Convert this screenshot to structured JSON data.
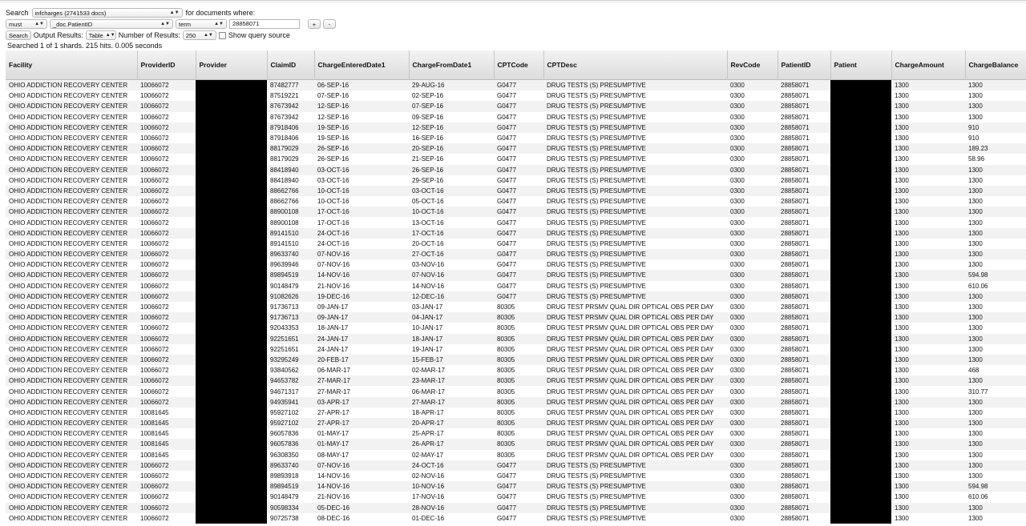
{
  "search_bar": {
    "search_label": "Search",
    "index_select": "infcharges (2741533 docs)",
    "for_documents_label": "for documents where:",
    "occur_select": "must",
    "field_select": "_doc.PatientID",
    "query_type_select": "term",
    "query_value": "28858071",
    "add_button": "+",
    "remove_button": "-",
    "search_button": "Search",
    "output_results_label": "Output Results:",
    "output_format_select": "Table",
    "number_of_results_label": "Number of Results:",
    "number_of_results_select": "250",
    "show_query_source_label": "Show query source"
  },
  "status_text": "Searched 1 of 1 shards. 215 hits. 0.005 seconds",
  "table": {
    "columns": [
      "Facility",
      "ProviderID",
      "Provider",
      "ClaimID",
      "ChargeEnteredDate1",
      "ChargeFromDate1",
      "CPTCode",
      "CPTDesc",
      "RevCode",
      "PatientID",
      "Patient",
      "ChargeAmount",
      "ChargeBalance"
    ],
    "rows": [
      [
        "OHIO ADDICTION RECOVERY CENTER",
        "10066072",
        "",
        "87482777",
        "06-SEP-16",
        "29-AUG-16",
        "G0477",
        "DRUG TESTS (S) PRESUMPTIVE",
        "0300",
        "28858071",
        "",
        "1300",
        "1300"
      ],
      [
        "OHIO ADDICTION RECOVERY CENTER",
        "10066072",
        "",
        "87519221",
        "07-SEP-16",
        "02-SEP-16",
        "G0477",
        "DRUG TESTS (S) PRESUMPTIVE",
        "0300",
        "28858071",
        "",
        "1300",
        "1300"
      ],
      [
        "OHIO ADDICTION RECOVERY CENTER",
        "10066072",
        "",
        "87673942",
        "12-SEP-16",
        "07-SEP-16",
        "G0477",
        "DRUG TESTS (S) PRESUMPTIVE",
        "0300",
        "28858071",
        "",
        "1300",
        "1300"
      ],
      [
        "OHIO ADDICTION RECOVERY CENTER",
        "10066072",
        "",
        "87673942",
        "12-SEP-16",
        "09-SEP-16",
        "G0477",
        "DRUG TESTS (S) PRESUMPTIVE",
        "0300",
        "28858071",
        "",
        "1300",
        "1300"
      ],
      [
        "OHIO ADDICTION RECOVERY CENTER",
        "10066072",
        "",
        "87918406",
        "19-SEP-16",
        "12-SEP-16",
        "G0477",
        "DRUG TESTS (S) PRESUMPTIVE",
        "0300",
        "28858071",
        "",
        "1300",
        "910"
      ],
      [
        "OHIO ADDICTION RECOVERY CENTER",
        "10066072",
        "",
        "87918406",
        "19-SEP-16",
        "16-SEP-16",
        "G0477",
        "DRUG TESTS (S) PRESUMPTIVE",
        "0300",
        "28858071",
        "",
        "1300",
        "910"
      ],
      [
        "OHIO ADDICTION RECOVERY CENTER",
        "10066072",
        "",
        "88179029",
        "26-SEP-16",
        "20-SEP-16",
        "G0477",
        "DRUG TESTS (S) PRESUMPTIVE",
        "0300",
        "28858071",
        "",
        "1300",
        "189.23"
      ],
      [
        "OHIO ADDICTION RECOVERY CENTER",
        "10066072",
        "",
        "88179029",
        "26-SEP-16",
        "21-SEP-16",
        "G0477",
        "DRUG TESTS (S) PRESUMPTIVE",
        "0300",
        "28858071",
        "",
        "1300",
        "58.96"
      ],
      [
        "OHIO ADDICTION RECOVERY CENTER",
        "10066072",
        "",
        "88418940",
        "03-OCT-16",
        "26-SEP-16",
        "G0477",
        "DRUG TESTS (S) PRESUMPTIVE",
        "0300",
        "28858071",
        "",
        "1300",
        "1300"
      ],
      [
        "OHIO ADDICTION RECOVERY CENTER",
        "10066072",
        "",
        "88418940",
        "03-OCT-16",
        "29-SEP-16",
        "G0477",
        "DRUG TESTS (S) PRESUMPTIVE",
        "0300",
        "28858071",
        "",
        "1300",
        "1300"
      ],
      [
        "OHIO ADDICTION RECOVERY CENTER",
        "10066072",
        "",
        "88662766",
        "10-OCT-16",
        "03-OCT-16",
        "G0477",
        "DRUG TESTS (S) PRESUMPTIVE",
        "0300",
        "28858071",
        "",
        "1300",
        "1300"
      ],
      [
        "OHIO ADDICTION RECOVERY CENTER",
        "10066072",
        "",
        "88662766",
        "10-OCT-16",
        "05-OCT-16",
        "G0477",
        "DRUG TESTS (S) PRESUMPTIVE",
        "0300",
        "28858071",
        "",
        "1300",
        "1300"
      ],
      [
        "OHIO ADDICTION RECOVERY CENTER",
        "10066072",
        "",
        "88900108",
        "17-OCT-16",
        "10-OCT-16",
        "G0477",
        "DRUG TESTS (S) PRESUMPTIVE",
        "0300",
        "28858071",
        "",
        "1300",
        "1300"
      ],
      [
        "OHIO ADDICTION RECOVERY CENTER",
        "10066072",
        "",
        "88900108",
        "17-OCT-16",
        "13-OCT-16",
        "G0477",
        "DRUG TESTS (S) PRESUMPTIVE",
        "0300",
        "28858071",
        "",
        "1300",
        "1300"
      ],
      [
        "OHIO ADDICTION RECOVERY CENTER",
        "10066072",
        "",
        "89141510",
        "24-OCT-16",
        "17-OCT-16",
        "G0477",
        "DRUG TESTS (S) PRESUMPTIVE",
        "0300",
        "28858071",
        "",
        "1300",
        "1300"
      ],
      [
        "OHIO ADDICTION RECOVERY CENTER",
        "10066072",
        "",
        "89141510",
        "24-OCT-16",
        "20-OCT-16",
        "G0477",
        "DRUG TESTS (S) PRESUMPTIVE",
        "0300",
        "28858071",
        "",
        "1300",
        "1300"
      ],
      [
        "OHIO ADDICTION RECOVERY CENTER",
        "10066072",
        "",
        "89633740",
        "07-NOV-16",
        "27-OCT-16",
        "G0477",
        "DRUG TESTS (S) PRESUMPTIVE",
        "0300",
        "28858071",
        "",
        "1300",
        "1300"
      ],
      [
        "OHIO ADDICTION RECOVERY CENTER",
        "10066072",
        "",
        "89639946",
        "07-NOV-16",
        "03-NOV-16",
        "G0477",
        "DRUG TESTS (S) PRESUMPTIVE",
        "0300",
        "28858071",
        "",
        "1300",
        "1300"
      ],
      [
        "OHIO ADDICTION RECOVERY CENTER",
        "10066072",
        "",
        "89894519",
        "14-NOV-16",
        "07-NOV-16",
        "G0477",
        "DRUG TESTS (S) PRESUMPTIVE",
        "0300",
        "28858071",
        "",
        "1300",
        "594.98"
      ],
      [
        "OHIO ADDICTION RECOVERY CENTER",
        "10066072",
        "",
        "90148479",
        "21-NOV-16",
        "14-NOV-16",
        "G0477",
        "DRUG TESTS (S) PRESUMPTIVE",
        "0300",
        "28858071",
        "",
        "1300",
        "610.06"
      ],
      [
        "OHIO ADDICTION RECOVERY CENTER",
        "10066072",
        "",
        "91082626",
        "19-DEC-16",
        "12-DEC-16",
        "G0477",
        "DRUG TESTS (S) PRESUMPTIVE",
        "0300",
        "28858071",
        "",
        "1300",
        "1300"
      ],
      [
        "OHIO ADDICTION RECOVERY CENTER",
        "10066072",
        "",
        "91736713",
        "09-JAN-17",
        "03-JAN-17",
        "80305",
        "DRUG TEST PRSMV QUAL DIR OPTICAL OBS PER DAY",
        "0300",
        "28858071",
        "",
        "1300",
        "1300"
      ],
      [
        "OHIO ADDICTION RECOVERY CENTER",
        "10066072",
        "",
        "91736713",
        "09-JAN-17",
        "04-JAN-17",
        "80305",
        "DRUG TEST PRSMV QUAL DIR OPTICAL OBS PER DAY",
        "0300",
        "28858071",
        "",
        "1300",
        "1300"
      ],
      [
        "OHIO ADDICTION RECOVERY CENTER",
        "10066072",
        "",
        "92043353",
        "18-JAN-17",
        "10-JAN-17",
        "80305",
        "DRUG TEST PRSMV QUAL DIR OPTICAL OBS PER DAY",
        "0300",
        "28858071",
        "",
        "1300",
        "1300"
      ],
      [
        "OHIO ADDICTION RECOVERY CENTER",
        "10066072",
        "",
        "92251651",
        "24-JAN-17",
        "18-JAN-17",
        "80305",
        "DRUG TEST PRSMV QUAL DIR OPTICAL OBS PER DAY",
        "0300",
        "28858071",
        "",
        "1300",
        "1300"
      ],
      [
        "OHIO ADDICTION RECOVERY CENTER",
        "10066072",
        "",
        "92251651",
        "24-JAN-17",
        "19-JAN-17",
        "80305",
        "DRUG TEST PRSMV QUAL DIR OPTICAL OBS PER DAY",
        "0300",
        "28858071",
        "",
        "1300",
        "1300"
      ],
      [
        "OHIO ADDICTION RECOVERY CENTER",
        "10066072",
        "",
        "93295249",
        "20-FEB-17",
        "15-FEB-17",
        "80305",
        "DRUG TEST PRSMV QUAL DIR OPTICAL OBS PER DAY",
        "0300",
        "28858071",
        "",
        "1300",
        "1300"
      ],
      [
        "OHIO ADDICTION RECOVERY CENTER",
        "10066072",
        "",
        "93840562",
        "06-MAR-17",
        "02-MAR-17",
        "80305",
        "DRUG TEST PRSMV QUAL DIR OPTICAL OBS PER DAY",
        "0300",
        "28858071",
        "",
        "1300",
        "468"
      ],
      [
        "OHIO ADDICTION RECOVERY CENTER",
        "10066072",
        "",
        "94653782",
        "27-MAR-17",
        "23-MAR-17",
        "80305",
        "DRUG TEST PRSMV QUAL DIR OPTICAL OBS PER DAY",
        "0300",
        "28858071",
        "",
        "1300",
        "1300"
      ],
      [
        "OHIO ADDICTION RECOVERY CENTER",
        "10066072",
        "",
        "94671317",
        "27-MAR-17",
        "06-MAR-17",
        "80305",
        "DRUG TEST PRSMV QUAL DIR OPTICAL OBS PER DAY",
        "0300",
        "28858071",
        "",
        "1300",
        "310.77"
      ],
      [
        "OHIO ADDICTION RECOVERY CENTER",
        "10066072",
        "",
        "94935941",
        "03-APR-17",
        "27-MAR-17",
        "80305",
        "DRUG TEST PRSMV QUAL DIR OPTICAL OBS PER DAY",
        "0300",
        "28858071",
        "",
        "1300",
        "1300"
      ],
      [
        "OHIO ADDICTION RECOVERY CENTER",
        "10081645",
        "",
        "95927102",
        "27-APR-17",
        "18-APR-17",
        "80305",
        "DRUG TEST PRSMV QUAL DIR OPTICAL OBS PER DAY",
        "0300",
        "28858071",
        "",
        "1300",
        "1300"
      ],
      [
        "OHIO ADDICTION RECOVERY CENTER",
        "10081645",
        "",
        "95927102",
        "27-APR-17",
        "20-APR-17",
        "80305",
        "DRUG TEST PRSMV QUAL DIR OPTICAL OBS PER DAY",
        "0300",
        "28858071",
        "",
        "1300",
        "1300"
      ],
      [
        "OHIO ADDICTION RECOVERY CENTER",
        "10081645",
        "",
        "96057836",
        "01-MAY-17",
        "25-APR-17",
        "80305",
        "DRUG TEST PRSMV QUAL DIR OPTICAL OBS PER DAY",
        "0300",
        "28858071",
        "",
        "1300",
        "1300"
      ],
      [
        "OHIO ADDICTION RECOVERY CENTER",
        "10081645",
        "",
        "96057836",
        "01-MAY-17",
        "26-APR-17",
        "80305",
        "DRUG TEST PRSMV QUAL DIR OPTICAL OBS PER DAY",
        "0300",
        "28858071",
        "",
        "1300",
        "1300"
      ],
      [
        "OHIO ADDICTION RECOVERY CENTER",
        "10081645",
        "",
        "96308350",
        "08-MAY-17",
        "02-MAY-17",
        "80305",
        "DRUG TEST PRSMV QUAL DIR OPTICAL OBS PER DAY",
        "0300",
        "28858071",
        "",
        "1300",
        "1300"
      ],
      [
        "OHIO ADDICTION RECOVERY CENTER",
        "10066072",
        "",
        "89633740",
        "07-NOV-16",
        "24-OCT-16",
        "G0477",
        "DRUG TESTS (S) PRESUMPTIVE",
        "0300",
        "28858071",
        "",
        "1300",
        "1300"
      ],
      [
        "OHIO ADDICTION RECOVERY CENTER",
        "10066072",
        "",
        "89893918",
        "14-NOV-16",
        "02-NOV-16",
        "G0477",
        "DRUG TESTS (S) PRESUMPTIVE",
        "0300",
        "28858071",
        "",
        "1300",
        "1300"
      ],
      [
        "OHIO ADDICTION RECOVERY CENTER",
        "10066072",
        "",
        "89894519",
        "14-NOV-16",
        "10-NOV-16",
        "G0477",
        "DRUG TESTS (S) PRESUMPTIVE",
        "0300",
        "28858071",
        "",
        "1300",
        "594.98"
      ],
      [
        "OHIO ADDICTION RECOVERY CENTER",
        "10066072",
        "",
        "90148479",
        "21-NOV-16",
        "17-NOV-16",
        "G0477",
        "DRUG TESTS (S) PRESUMPTIVE",
        "0300",
        "28858071",
        "",
        "1300",
        "610.06"
      ],
      [
        "OHIO ADDICTION RECOVERY CENTER",
        "10066072",
        "",
        "90598334",
        "05-DEC-16",
        "28-NOV-16",
        "G0477",
        "DRUG TESTS (S) PRESUMPTIVE",
        "0300",
        "28858071",
        "",
        "1300",
        "1300"
      ],
      [
        "OHIO ADDICTION RECOVERY CENTER",
        "10066072",
        "",
        "90725738",
        "08-DEC-16",
        "01-DEC-16",
        "G0477",
        "DRUG TESTS (S) PRESUMPTIVE",
        "0300",
        "28858071",
        "",
        "1300",
        "1300"
      ]
    ]
  }
}
